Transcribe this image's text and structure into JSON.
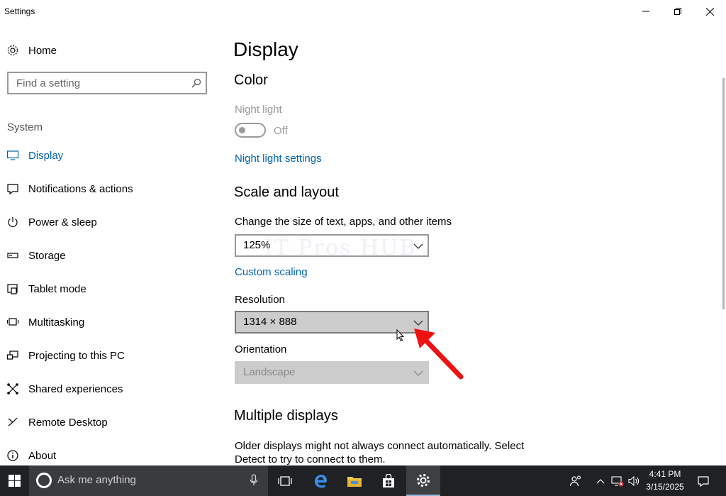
{
  "window": {
    "title": "Settings",
    "minimize_icon": "minimize-icon",
    "maximize_icon": "restore-icon",
    "close_icon": "close-icon"
  },
  "sidebar": {
    "home_label": "Home",
    "search_placeholder": "Find a setting",
    "section": "System",
    "items": [
      {
        "label": "Display",
        "icon": "monitor-icon",
        "active": true
      },
      {
        "label": "Notifications & actions",
        "icon": "notification-icon",
        "active": false
      },
      {
        "label": "Power & sleep",
        "icon": "power-icon",
        "active": false
      },
      {
        "label": "Storage",
        "icon": "storage-icon",
        "active": false
      },
      {
        "label": "Tablet mode",
        "icon": "tablet-icon",
        "active": false
      },
      {
        "label": "Multitasking",
        "icon": "multitasking-icon",
        "active": false
      },
      {
        "label": "Projecting to this PC",
        "icon": "project-icon",
        "active": false
      },
      {
        "label": "Shared experiences",
        "icon": "shared-icon",
        "active": false
      },
      {
        "label": "Remote Desktop",
        "icon": "remote-icon",
        "active": false
      },
      {
        "label": "About",
        "icon": "info-icon",
        "active": false
      }
    ]
  },
  "main": {
    "title": "Display",
    "color_heading": "Color",
    "night_light_label": "Night light",
    "night_light_state": "Off",
    "night_light_settings_link": "Night light settings",
    "scale_heading": "Scale and layout",
    "scale_label": "Change the size of text, apps, and other items",
    "scale_value": "125%",
    "custom_scaling_link": "Custom scaling",
    "resolution_label": "Resolution",
    "resolution_value": "1314 × 888",
    "orientation_label": "Orientation",
    "orientation_value": "Landscape",
    "multiple_heading": "Multiple displays",
    "multiple_desc": "Older displays might not always connect automatically. Select Detect to try to connect to them.",
    "watermark": "IT Pros HUB"
  },
  "taskbar": {
    "search_placeholder": "Ask me anything",
    "time": "4:41 PM",
    "date": "3/15/2025",
    "apps": [
      "task-view-icon",
      "edge-icon",
      "file-explorer-icon",
      "store-icon",
      "settings-icon"
    ],
    "colors": {
      "background": "#1f2125",
      "accent": "#0063b1"
    }
  }
}
